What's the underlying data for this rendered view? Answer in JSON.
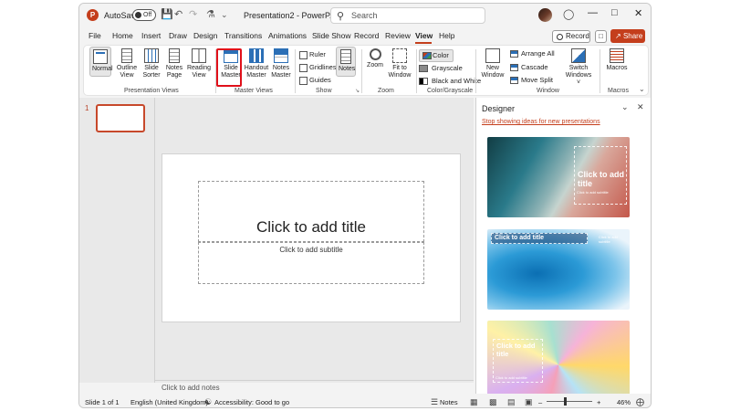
{
  "titlebar": {
    "logo": "P",
    "autosave_label": "AutoSave",
    "autosave_state": "Off",
    "doc_title": "Presentation2 - PowerP...",
    "search_placeholder": "Search",
    "icons": {
      "save": "floppy-icon",
      "undo": "undo-icon",
      "redo": "redo-icon",
      "customize": "customize-icon",
      "more": "chevron-down-icon",
      "search": "search-icon",
      "bulb": "lightbulb-icon",
      "minimize": "minimize-icon",
      "maximize": "maximize-icon",
      "close": "close-icon"
    }
  },
  "tabs": [
    "File",
    "Home",
    "Insert",
    "Draw",
    "Design",
    "Transitions",
    "Animations",
    "Slide Show",
    "Record",
    "Review",
    "View",
    "Help"
  ],
  "active_tab": "View",
  "header_buttons": {
    "record": "Record",
    "share": "Share"
  },
  "ribbon": {
    "presentation_views": {
      "label": "Presentation Views",
      "buttons": [
        {
          "line1": "Normal",
          "line2": ""
        },
        {
          "line1": "Outline",
          "line2": "View"
        },
        {
          "line1": "Slide",
          "line2": "Sorter"
        },
        {
          "line1": "Notes",
          "line2": "Page"
        },
        {
          "line1": "Reading",
          "line2": "View"
        }
      ]
    },
    "master_views": {
      "label": "Master Views",
      "buttons": [
        {
          "line1": "Slide",
          "line2": "Master"
        },
        {
          "line1": "Handout",
          "line2": "Master"
        },
        {
          "line1": "Notes",
          "line2": "Master"
        }
      ]
    },
    "show": {
      "label": "Show",
      "ruler": "Ruler",
      "gridlines": "Gridlines",
      "guides": "Guides",
      "notes": "Notes"
    },
    "zoom": {
      "label": "Zoom",
      "zoom": "Zoom",
      "fit_line1": "Fit to",
      "fit_line2": "Window"
    },
    "color": {
      "label": "Color/Grayscale",
      "color": "Color",
      "grayscale": "Grayscale",
      "bw": "Black and White",
      "swatches": {
        "color": "#c43e1c",
        "grayscale": "#8a8a8a",
        "bw": "#000000"
      }
    },
    "window": {
      "label": "Window",
      "new_line1": "New",
      "new_line2": "Window",
      "arrange_all": "Arrange All",
      "cascade": "Cascade",
      "move_split": "Move Split",
      "switch_line1": "Switch",
      "switch_line2": "Windows ˅"
    },
    "macros": {
      "label": "Macros",
      "button": "Macros"
    }
  },
  "slides_panel": {
    "slide_number": "1"
  },
  "slide": {
    "title_placeholder": "Click to add title",
    "subtitle_placeholder": "Click to add subtitle"
  },
  "notes_placeholder": "Click to add notes",
  "designer": {
    "title": "Designer",
    "link": "Stop showing ideas for new presentations",
    "cards": [
      {
        "title": "Click to add title",
        "subtitle": "Click to add subtitle"
      },
      {
        "title": "Click to add title",
        "subtitle": "Click to add subtitle"
      },
      {
        "title": "Click to add title",
        "subtitle": "Click to add subtitle"
      }
    ]
  },
  "statusbar": {
    "slide_count": "Slide 1 of 1",
    "language": "English (United Kingdom)",
    "accessibility": "Accessibility: Good to go",
    "notes": "Notes",
    "zoom_level": "46%"
  },
  "colors": {
    "accent": "#c43e1c",
    "highlight": "#e0101a",
    "brand_blue": "#2b6fb6"
  }
}
